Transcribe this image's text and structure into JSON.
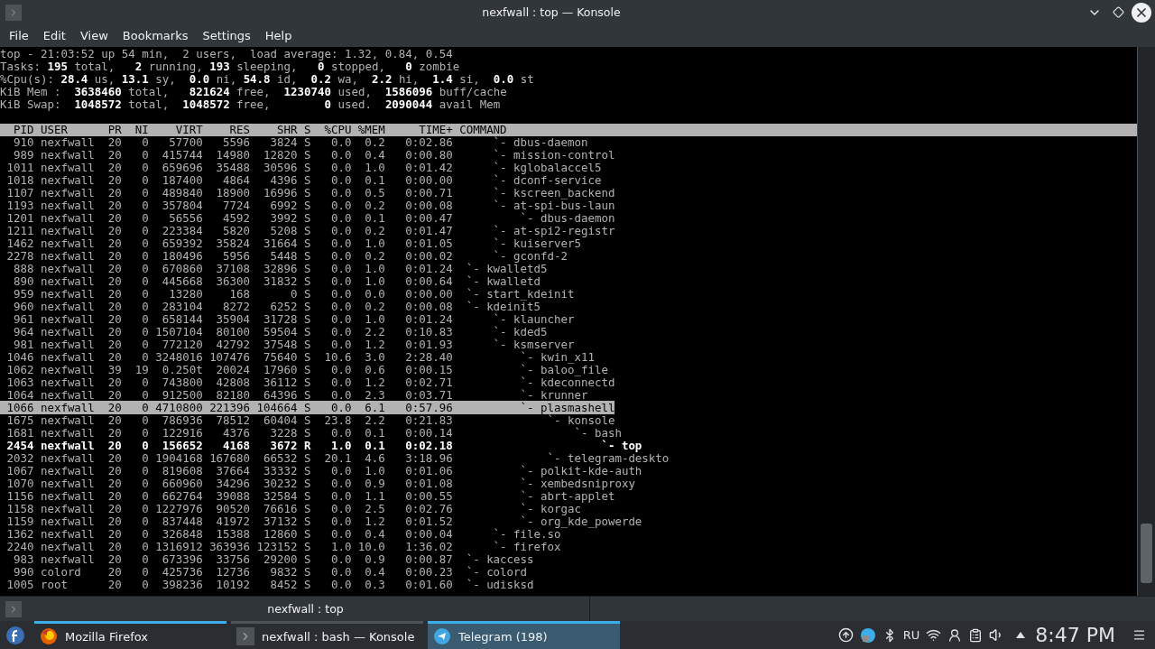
{
  "window": {
    "title": "nexfwall : top — Konsole"
  },
  "menu": [
    "File",
    "Edit",
    "View",
    "Bookmarks",
    "Settings",
    "Help"
  ],
  "terminal": {
    "summary": [
      "top - 21:03:52 up 54 min,  2 users,  load average: 1.32, 0.84, 0.54",
      "Tasks: **195** total,   **2** running, **193** sleeping,   **0** stopped,   **0** zombie",
      "%Cpu(s): **28.4** us, **13.1** sy,  **0.0** ni, **54.8** id,  **0.2** wa,  **2.2** hi,  **1.4** si,  **0.0** st",
      "KiB Mem :  **3638460** total,   **821624** free,  **1230740** used,  **1586096** buff/cache",
      "KiB Swap:  **1048572** total,  **1048572** free,        **0** used.  **2090044** avail Mem"
    ],
    "columns": [
      "PID",
      "USER",
      "PR",
      "NI",
      "VIRT",
      "RES",
      "SHR",
      "S",
      "%CPU",
      "%MEM",
      "TIME+",
      "COMMAND"
    ],
    "rows": [
      {
        "cells": [
          "910",
          "nexfwall",
          "20",
          "0",
          "57700",
          "5596",
          "3824",
          "S",
          "0.0",
          "0.2",
          "0:02.86",
          "     `- dbus-daemon"
        ],
        "selected": false,
        "bold": false
      },
      {
        "cells": [
          "989",
          "nexfwall",
          "20",
          "0",
          "415744",
          "14980",
          "12820",
          "S",
          "0.0",
          "0.4",
          "0:00.80",
          "     `- mission-control"
        ],
        "selected": false,
        "bold": false
      },
      {
        "cells": [
          "1011",
          "nexfwall",
          "20",
          "0",
          "659696",
          "35488",
          "30596",
          "S",
          "0.0",
          "1.0",
          "0:01.42",
          "     `- kglobalaccel5"
        ],
        "selected": false,
        "bold": false
      },
      {
        "cells": [
          "1018",
          "nexfwall",
          "20",
          "0",
          "187400",
          "4864",
          "4396",
          "S",
          "0.0",
          "0.1",
          "0:00.00",
          "     `- dconf-service"
        ],
        "selected": false,
        "bold": false
      },
      {
        "cells": [
          "1107",
          "nexfwall",
          "20",
          "0",
          "489840",
          "18900",
          "16996",
          "S",
          "0.0",
          "0.5",
          "0:00.71",
          "     `- kscreen_backend"
        ],
        "selected": false,
        "bold": false
      },
      {
        "cells": [
          "1193",
          "nexfwall",
          "20",
          "0",
          "357804",
          "7724",
          "6992",
          "S",
          "0.0",
          "0.2",
          "0:00.08",
          "     `- at-spi-bus-laun"
        ],
        "selected": false,
        "bold": false
      },
      {
        "cells": [
          "1201",
          "nexfwall",
          "20",
          "0",
          "56556",
          "4592",
          "3992",
          "S",
          "0.0",
          "0.1",
          "0:00.47",
          "         `- dbus-daemon"
        ],
        "selected": false,
        "bold": false
      },
      {
        "cells": [
          "1211",
          "nexfwall",
          "20",
          "0",
          "223384",
          "5820",
          "5208",
          "S",
          "0.0",
          "0.2",
          "0:01.47",
          "     `- at-spi2-registr"
        ],
        "selected": false,
        "bold": false
      },
      {
        "cells": [
          "1462",
          "nexfwall",
          "20",
          "0",
          "659392",
          "35824",
          "31664",
          "S",
          "0.0",
          "1.0",
          "0:01.05",
          "     `- kuiserver5"
        ],
        "selected": false,
        "bold": false
      },
      {
        "cells": [
          "2278",
          "nexfwall",
          "20",
          "0",
          "180496",
          "5956",
          "5448",
          "S",
          "0.0",
          "0.2",
          "0:00.02",
          "     `- gconfd-2"
        ],
        "selected": false,
        "bold": false
      },
      {
        "cells": [
          "888",
          "nexfwall",
          "20",
          "0",
          "670860",
          "37108",
          "32896",
          "S",
          "0.0",
          "1.0",
          "0:01.24",
          " `- kwalletd5"
        ],
        "selected": false,
        "bold": false
      },
      {
        "cells": [
          "890",
          "nexfwall",
          "20",
          "0",
          "445668",
          "36300",
          "31832",
          "S",
          "0.0",
          "1.0",
          "0:00.64",
          " `- kwalletd"
        ],
        "selected": false,
        "bold": false
      },
      {
        "cells": [
          "959",
          "nexfwall",
          "20",
          "0",
          "13280",
          "168",
          "0",
          "S",
          "0.0",
          "0.0",
          "0:00.00",
          " `- start_kdeinit"
        ],
        "selected": false,
        "bold": false
      },
      {
        "cells": [
          "960",
          "nexfwall",
          "20",
          "0",
          "283104",
          "8272",
          "6252",
          "S",
          "0.0",
          "0.2",
          "0:00.08",
          " `- kdeinit5"
        ],
        "selected": false,
        "bold": false
      },
      {
        "cells": [
          "961",
          "nexfwall",
          "20",
          "0",
          "658144",
          "35904",
          "31728",
          "S",
          "0.0",
          "1.0",
          "0:01.24",
          "     `- klauncher"
        ],
        "selected": false,
        "bold": false
      },
      {
        "cells": [
          "964",
          "nexfwall",
          "20",
          "0",
          "1507104",
          "80100",
          "59504",
          "S",
          "0.0",
          "2.2",
          "0:10.83",
          "     `- kded5"
        ],
        "selected": false,
        "bold": false
      },
      {
        "cells": [
          "981",
          "nexfwall",
          "20",
          "0",
          "772120",
          "42792",
          "37548",
          "S",
          "0.0",
          "1.2",
          "0:01.93",
          "     `- ksmserver"
        ],
        "selected": false,
        "bold": false
      },
      {
        "cells": [
          "1046",
          "nexfwall",
          "20",
          "0",
          "3248016",
          "107476",
          "75640",
          "S",
          "10.6",
          "3.0",
          "2:28.40",
          "         `- kwin_x11"
        ],
        "selected": false,
        "bold": false
      },
      {
        "cells": [
          "1062",
          "nexfwall",
          "39",
          "19",
          "0.250t",
          "20024",
          "17960",
          "S",
          "0.0",
          "0.6",
          "0:00.15",
          "         `- baloo_file"
        ],
        "selected": false,
        "bold": false
      },
      {
        "cells": [
          "1063",
          "nexfwall",
          "20",
          "0",
          "743800",
          "42808",
          "36112",
          "S",
          "0.0",
          "1.2",
          "0:02.71",
          "         `- kdeconnectd"
        ],
        "selected": false,
        "bold": false
      },
      {
        "cells": [
          "1064",
          "nexfwall",
          "20",
          "0",
          "912500",
          "82180",
          "64396",
          "S",
          "0.0",
          "2.3",
          "0:03.71",
          "         `- krunner"
        ],
        "selected": false,
        "bold": false
      },
      {
        "cells": [
          "1066",
          "nexfwall",
          "20",
          "0",
          "4710800",
          "221396",
          "104664",
          "S",
          "0.0",
          "6.1",
          "0:57.96",
          "         `- plasmashell"
        ],
        "selected": true,
        "bold": false
      },
      {
        "cells": [
          "1675",
          "nexfwall",
          "20",
          "0",
          "786936",
          "78512",
          "60404",
          "S",
          "23.8",
          "2.2",
          "0:21.83",
          "             `- konsole"
        ],
        "selected": false,
        "bold": false
      },
      {
        "cells": [
          "1681",
          "nexfwall",
          "20",
          "0",
          "122916",
          "4376",
          "3228",
          "S",
          "0.0",
          "0.1",
          "0:00.14",
          "                 `- bash"
        ],
        "selected": false,
        "bold": false
      },
      {
        "cells": [
          "2454",
          "nexfwall",
          "20",
          "0",
          "156652",
          "4168",
          "3672",
          "R",
          "1.0",
          "0.1",
          "0:02.18",
          "                     `- top"
        ],
        "selected": false,
        "bold": true
      },
      {
        "cells": [
          "2032",
          "nexfwall",
          "20",
          "0",
          "1904168",
          "167680",
          "66532",
          "S",
          "20.1",
          "4.6",
          "3:18.96",
          "             `- telegram-deskto"
        ],
        "selected": false,
        "bold": false
      },
      {
        "cells": [
          "1067",
          "nexfwall",
          "20",
          "0",
          "819608",
          "37664",
          "33332",
          "S",
          "0.0",
          "1.0",
          "0:01.06",
          "         `- polkit-kde-auth"
        ],
        "selected": false,
        "bold": false
      },
      {
        "cells": [
          "1070",
          "nexfwall",
          "20",
          "0",
          "660960",
          "34296",
          "30232",
          "S",
          "0.0",
          "0.9",
          "0:01.08",
          "         `- xembedsniproxy"
        ],
        "selected": false,
        "bold": false
      },
      {
        "cells": [
          "1156",
          "nexfwall",
          "20",
          "0",
          "662764",
          "39088",
          "32584",
          "S",
          "0.0",
          "1.1",
          "0:00.55",
          "         `- abrt-applet"
        ],
        "selected": false,
        "bold": false
      },
      {
        "cells": [
          "1158",
          "nexfwall",
          "20",
          "0",
          "1227976",
          "90520",
          "76616",
          "S",
          "0.0",
          "2.5",
          "0:02.76",
          "         `- korgac"
        ],
        "selected": false,
        "bold": false
      },
      {
        "cells": [
          "1159",
          "nexfwall",
          "20",
          "0",
          "837448",
          "41972",
          "37132",
          "S",
          "0.0",
          "1.2",
          "0:01.52",
          "         `- org_kde_powerde"
        ],
        "selected": false,
        "bold": false
      },
      {
        "cells": [
          "1362",
          "nexfwall",
          "20",
          "0",
          "326848",
          "15388",
          "12860",
          "S",
          "0.0",
          "0.4",
          "0:00.04",
          "     `- file.so"
        ],
        "selected": false,
        "bold": false
      },
      {
        "cells": [
          "2240",
          "nexfwall",
          "20",
          "0",
          "1316912",
          "363936",
          "123152",
          "S",
          "1.0",
          "10.0",
          "1:36.02",
          "     `- firefox"
        ],
        "selected": false,
        "bold": false
      },
      {
        "cells": [
          "983",
          "nexfwall",
          "20",
          "0",
          "673396",
          "33756",
          "29200",
          "S",
          "0.0",
          "0.9",
          "0:00.87",
          " `- kaccess"
        ],
        "selected": false,
        "bold": false
      },
      {
        "cells": [
          "990",
          "colord",
          "20",
          "0",
          "425736",
          "12736",
          "9832",
          "S",
          "0.0",
          "0.4",
          "0:00.23",
          " `- colord"
        ],
        "selected": false,
        "bold": false
      },
      {
        "cells": [
          "1005",
          "root",
          "20",
          "0",
          "398236",
          "10192",
          "8452",
          "S",
          "0.0",
          "0.3",
          "0:01.60",
          " `- udisksd"
        ],
        "selected": false,
        "bold": false
      }
    ]
  },
  "tab_bar": {
    "title": "nexfwall : top"
  },
  "taskbar": {
    "tasks": [
      {
        "kind": "browser",
        "label": "Mozilla Firefox",
        "selected": false,
        "highlighted": true
      },
      {
        "kind": "terminal",
        "label": "nexfwall : bash — Konsole",
        "selected": false,
        "highlighted": false
      },
      {
        "kind": "messenger",
        "label": "Telegram (198)",
        "selected": true,
        "highlighted": true
      }
    ],
    "keyboard_layout": "RU",
    "clock": "8:47 PM"
  }
}
